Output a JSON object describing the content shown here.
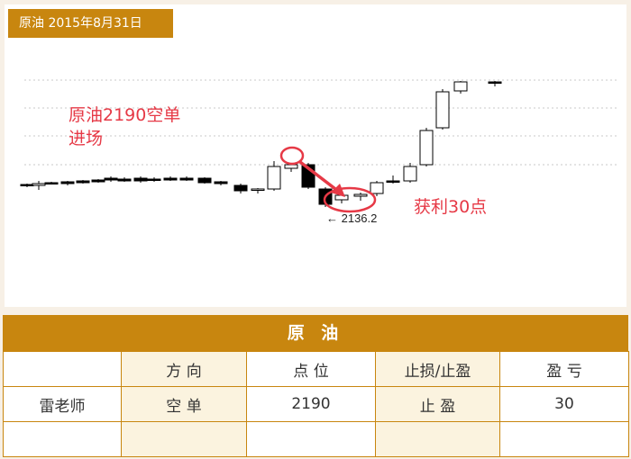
{
  "header": {
    "date_label": "原油 2015年8月31日"
  },
  "chart_data": {
    "type": "candlestick",
    "annotations": {
      "entry_text_line1": "原油2190空单",
      "entry_text_line2": "进场",
      "profit_text": "获利30点",
      "price_marker": "← 2136.2"
    },
    "colors": {
      "annotation": "#e63946",
      "up": "#ffffff",
      "down": "#000000",
      "accent": "#c8860f"
    }
  },
  "table": {
    "title": "原 油",
    "headers": [
      "",
      "方 向",
      "点 位",
      "止损/止盈",
      "盈 亏"
    ],
    "rows": [
      [
        "雷老师",
        "空 单",
        "2190",
        "止 盈",
        "30"
      ],
      [
        "",
        "",
        "",
        "",
        ""
      ]
    ]
  }
}
